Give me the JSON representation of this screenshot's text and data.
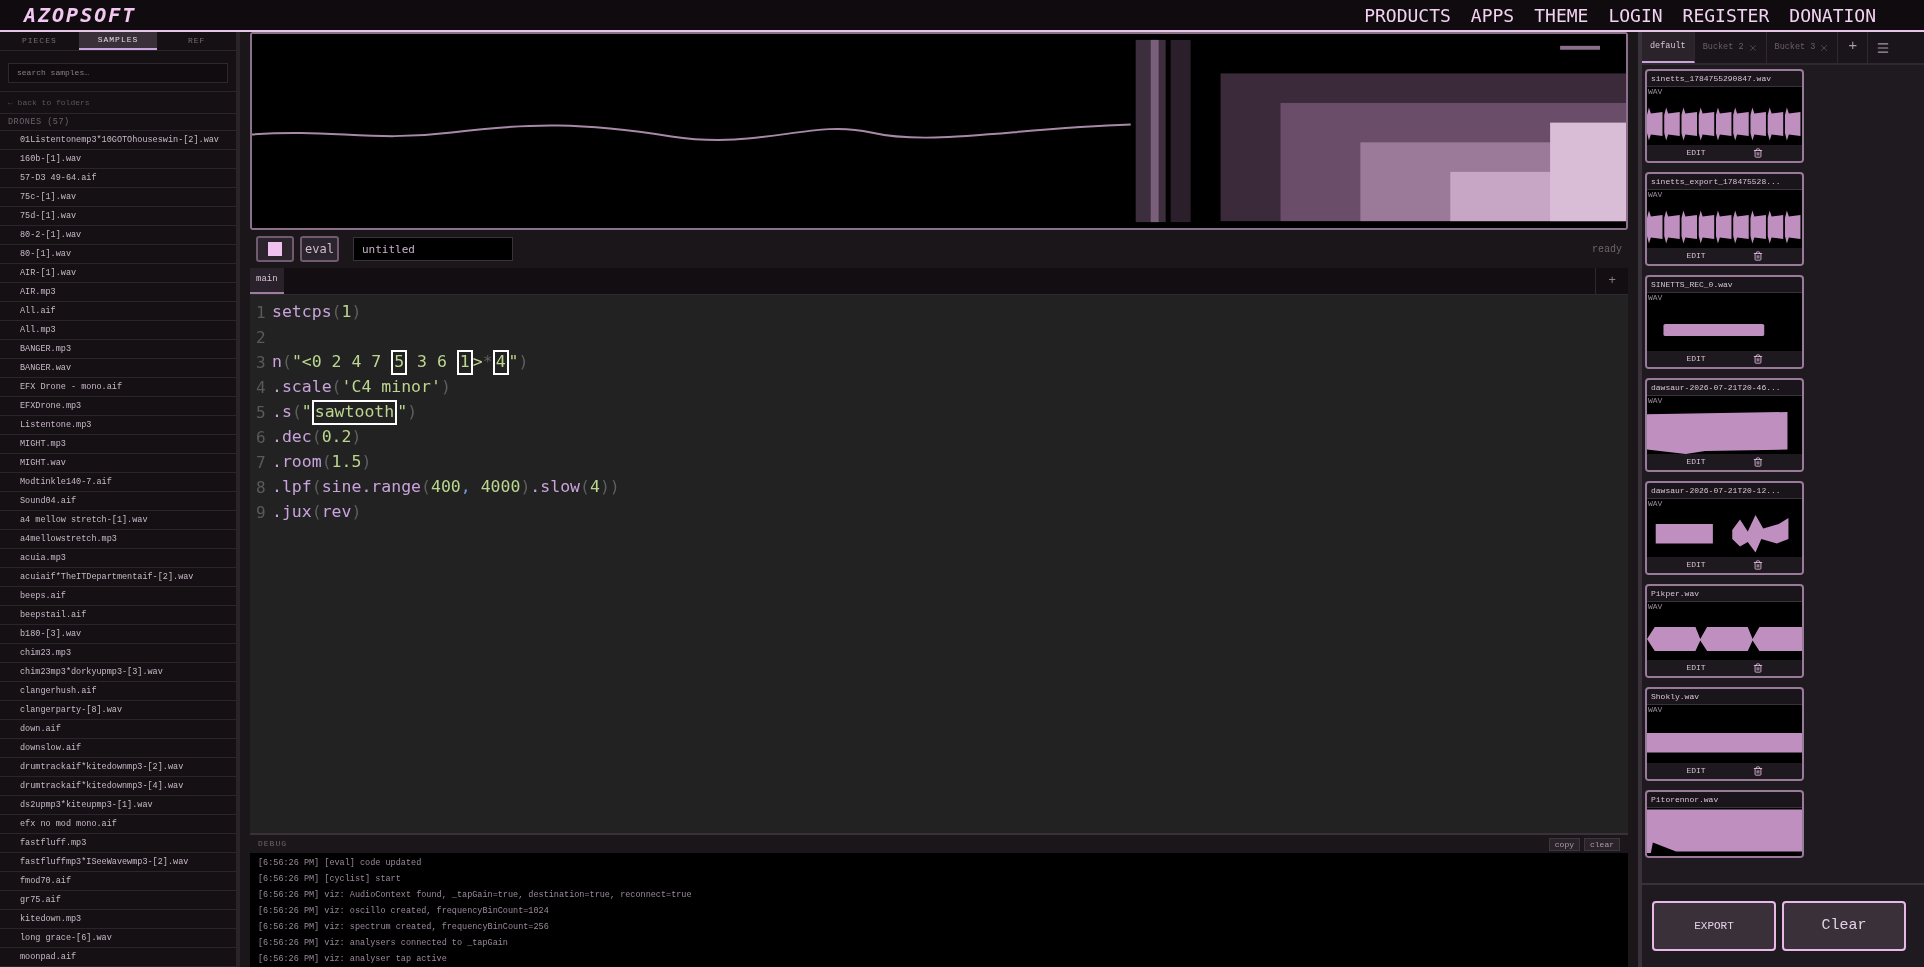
{
  "header": {
    "logo": "AZOPSOFT",
    "nav": [
      "PRODUCTS",
      "APPS",
      "THEME",
      "LOGIN",
      "REGISTER",
      "DONATION"
    ]
  },
  "sidebar": {
    "tabs": [
      {
        "label": "PIECES",
        "selected": false
      },
      {
        "label": "SAMPLES",
        "selected": true
      },
      {
        "label": "REF",
        "selected": false
      }
    ],
    "search": {
      "placeholder": "search samples…"
    },
    "back": "← back to folders",
    "folder": "DRONES (57)",
    "files": [
      "01Listentonemp3*10GOTOhouseswin-[2].wav",
      "160b-[1].wav",
      "57-D3 49-64.aif",
      "75c-[1].wav",
      "75d-[1].wav",
      "80-2-[1].wav",
      "80-[1].wav",
      "AIR-[1].wav",
      "AIR.mp3",
      "All.aif",
      "All.mp3",
      "BANGER.mp3",
      "BANGER.wav",
      "EFX Drone - mono.aif",
      "EFXDrone.mp3",
      "Listentone.mp3",
      "MIGHT.mp3",
      "MIGHT.wav",
      "Modtinkle140-7.aif",
      "Sound04.aif",
      "a4 mellow stretch-[1].wav",
      "a4mellowstretch.mp3",
      "acuia.mp3",
      "acuiaif*TheITDepartmentaif-[2].wav",
      "beeps.aif",
      "beepstail.aif",
      "b180-[3].wav",
      "chim23.mp3",
      "chim23mp3*dorkyupmp3-[3].wav",
      "clangerhush.aif",
      "clangerparty-[8].wav",
      "down.aif",
      "downslow.aif",
      "drumtrackaif*kitedownmp3-[2].wav",
      "drumtrackaif*kitedownmp3-[4].wav",
      "ds2upmp3*kiteupmp3-[1].wav",
      "efx no mod mono.aif",
      "fastfluff.mp3",
      "fastfluffmp3*ISeeWavewmp3-[2].wav",
      "fmod70.aif",
      "gr75.aif",
      "kitedown.mp3",
      "long grace-[6].wav",
      "moonpad.aif"
    ]
  },
  "toolbar": {
    "eval": "eval",
    "name": "untitled",
    "status": "ready"
  },
  "editor_tabs": [
    {
      "label": "main",
      "selected": true
    }
  ],
  "editor_add": "+",
  "code": [
    {
      "number": "1",
      "tokens": [
        {
          "t": "setcps",
          "kind": "fn",
          "boxed": false
        },
        {
          "t": "(",
          "kind": "p",
          "boxed": false
        },
        {
          "t": "1",
          "kind": "num",
          "boxed": false
        },
        {
          "t": ")",
          "kind": "p",
          "boxed": false
        }
      ]
    },
    {
      "number": "2"
    },
    {
      "number": "3",
      "tokens": [
        {
          "t": "n",
          "kind": "fn",
          "boxed": false
        },
        {
          "t": "(",
          "kind": "p",
          "boxed": false
        },
        {
          "t": "\"<0 2 4 7 ",
          "kind": "str",
          "boxed": false
        },
        {
          "t": "5",
          "kind": "str",
          "boxed": true
        },
        {
          "t": " 3 6 ",
          "kind": "str",
          "boxed": false
        },
        {
          "t": "1",
          "kind": "str",
          "boxed": true
        },
        {
          "t": ">",
          "kind": "str",
          "boxed": false
        },
        {
          "t": "*",
          "kind": "p",
          "boxed": false
        },
        {
          "t": "4",
          "kind": "str",
          "boxed": true
        },
        {
          "t": "\"",
          "kind": "str",
          "boxed": false
        },
        {
          "t": ")",
          "kind": "p",
          "boxed": false
        }
      ]
    },
    {
      "number": "4",
      "tokens": [
        {
          "t": ".scale",
          "kind": "fn",
          "boxed": false
        },
        {
          "t": "(",
          "kind": "p",
          "boxed": false
        },
        {
          "t": "'C4 minor'",
          "kind": "str",
          "boxed": false
        },
        {
          "t": ")",
          "kind": "p",
          "boxed": false
        }
      ]
    },
    {
      "number": "5",
      "tokens": [
        {
          "t": ".s",
          "kind": "fn",
          "boxed": false
        },
        {
          "t": "(",
          "kind": "p",
          "boxed": false
        },
        {
          "t": "\"",
          "kind": "str",
          "boxed": false
        },
        {
          "t": "sawtooth",
          "kind": "str",
          "boxed": true
        },
        {
          "t": "\"",
          "kind": "str",
          "boxed": false
        },
        {
          "t": ")",
          "kind": "p",
          "boxed": false
        }
      ]
    },
    {
      "number": "6",
      "tokens": [
        {
          "t": ".dec",
          "kind": "fn",
          "boxed": false
        },
        {
          "t": "(",
          "kind": "p",
          "boxed": false
        },
        {
          "t": "0.2",
          "kind": "num",
          "boxed": false
        },
        {
          "t": ")",
          "kind": "p",
          "boxed": false
        }
      ]
    },
    {
      "number": "7",
      "tokens": [
        {
          "t": ".room",
          "kind": "fn",
          "boxed": false
        },
        {
          "t": "(",
          "kind": "p",
          "boxed": false
        },
        {
          "t": "1.5",
          "kind": "num",
          "boxed": false
        },
        {
          "t": ")",
          "kind": "p",
          "boxed": false
        }
      ]
    },
    {
      "number": "8",
      "tokens": [
        {
          "t": ".lpf",
          "kind": "fn",
          "boxed": false
        },
        {
          "t": "(",
          "kind": "p",
          "boxed": false
        },
        {
          "t": "sine.range",
          "kind": "fn",
          "boxed": false
        },
        {
          "t": "(",
          "kind": "p",
          "boxed": false
        },
        {
          "t": "400",
          "kind": "num",
          "boxed": false
        },
        {
          "t": ", ",
          "kind": "sep",
          "boxed": false
        },
        {
          "t": "4000",
          "kind": "num",
          "boxed": false
        },
        {
          "t": ")",
          "kind": "p",
          "boxed": false
        },
        {
          "t": ".slow",
          "kind": "fn",
          "boxed": false
        },
        {
          "t": "(",
          "kind": "p",
          "boxed": false
        },
        {
          "t": "4",
          "kind": "num",
          "boxed": false
        },
        {
          "t": "))",
          "kind": "p",
          "boxed": false
        }
      ]
    },
    {
      "number": "9",
      "tokens": [
        {
          "t": ".jux",
          "kind": "fn",
          "boxed": false
        },
        {
          "t": "(",
          "kind": "p",
          "boxed": false
        },
        {
          "t": "rev",
          "kind": "fn",
          "boxed": false
        },
        {
          "t": ")",
          "kind": "p",
          "boxed": false
        }
      ]
    }
  ],
  "debug": {
    "title": "DEBUG",
    "buttons": [
      "copy",
      "clear"
    ],
    "lines": [
      "[6:56:26 PM] [eval] code updated",
      "[6:56:26 PM] [cyclist] start",
      "[6:56:26 PM] viz: AudioContext found, _tapGain=true, destination=true, reconnect=true",
      "[6:56:26 PM] viz: oscillo created, frequencyBinCount=1024",
      "[6:56:26 PM] viz: spectrum created, frequencyBinCount=256",
      "[6:56:26 PM] viz: analysers connected to _tapGain",
      "[6:56:26 PM] viz: analyser tap active"
    ]
  },
  "buckets": {
    "tabs": [
      {
        "label": "default",
        "selected": true,
        "closable": false
      },
      {
        "label": "Bucket 2",
        "selected": false,
        "closable": true
      },
      {
        "label": "Bucket 3",
        "selected": false,
        "closable": true
      }
    ],
    "add": "+"
  },
  "samples": [
    {
      "name": "sinetts_1784755290847.wav",
      "format": "WAV",
      "kind": "pulses",
      "edit": "EDIT"
    },
    {
      "name": "sinetts_export_178475528...",
      "format": "WAV",
      "kind": "pulses",
      "edit": "EDIT"
    },
    {
      "name": "SINETTS_REC_0.wav",
      "format": "WAV",
      "kind": "short",
      "edit": "EDIT"
    },
    {
      "name": "dawsaur-2026-07-21T20-46...",
      "format": "WAV",
      "kind": "block",
      "edit": "EDIT"
    },
    {
      "name": "dawsaur-2026-07-21T20-12...",
      "format": "WAV",
      "kind": "bursts",
      "edit": "EDIT"
    },
    {
      "name": "Pikper.wav",
      "format": "WAV",
      "kind": "diamonds",
      "edit": "EDIT"
    },
    {
      "name": "Shokly.wav",
      "format": "WAV",
      "kind": "band",
      "edit": "EDIT"
    },
    {
      "name": "Pitorennor.wav",
      "kind": "full"
    }
  ],
  "footer_buttons": [
    "EXPORT",
    "Clear"
  ]
}
